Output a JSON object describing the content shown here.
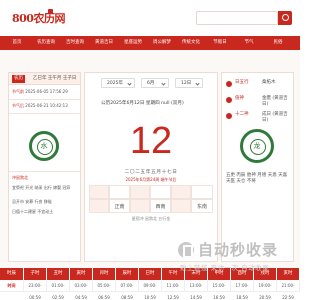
{
  "header": {
    "logo": "800农历网",
    "search_placeholder": ""
  },
  "nav": [
    "首页",
    "农历查询",
    "吉时查询",
    "黄道吉日",
    "星座运势",
    "周公解梦",
    "传统文化",
    "节假日",
    "节气",
    "民俗"
  ],
  "left_card": {
    "tag": "农历",
    "date": "乙巳年 壬午月 壬子日",
    "rows": [
      {
        "label": "节气前",
        "value": "2025-06-05 17:56:29"
      },
      {
        "label": "节气后",
        "value": "2025-06-21 10:42:13"
      }
    ],
    "ring_char": "水",
    "bottom_lines": [
      "冲鼠煞北",
      "宜祭祀 开光 纳采 出行 嫁娶 冠笄",
      "忌开市 安葬 行丧 移徙",
      "日值十二建星 不宜动土"
    ]
  },
  "center": {
    "year_sel": "2025年",
    "month_sel": "6月",
    "day_sel": "12日",
    "date_line": "公历2025年6月12日  星期四  null  (双月)",
    "day_number": "12",
    "lunar": "二〇二五年五月十七日",
    "holiday": "2025年6月第24周 端午节后",
    "grid_row1": [
      "",
      "",
      "",
      "",
      "",
      ""
    ],
    "grid_row2": [
      "",
      "正南",
      "",
      "西南",
      "",
      "东南"
    ],
    "footer": "星宿冲 鼠煞北 五行金"
  },
  "right_card": {
    "rows": [
      {
        "label": "日五行",
        "value": "桑柘木"
      },
      {
        "label": "值神",
        "value": "金匮 (黄道吉日)"
      },
      {
        "label": "十二神",
        "value": "成日 (黄道吉日)"
      }
    ],
    "ring_char": "龙",
    "bottom_text": "五更 丙辰 胎神 月德 天恩 天喜 天医 天仓 不将"
  },
  "table": {
    "headers": [
      "时辰",
      "子时",
      "丑时",
      "寅时",
      "卯时",
      "辰时",
      "巳时",
      "午时",
      "未时",
      "申时",
      "酉时",
      "戌时",
      "亥时"
    ],
    "values": [
      "时间",
      "23:00-00:59",
      "01:00-02:59",
      "03:00-04:59",
      "05:00-06:59",
      "07:00-08:59",
      "09:00-10:59",
      "11:00-12:59",
      "13:00-14:59",
      "15:00-16:59",
      "17:00-18:59",
      "19:00-20:59",
      "21:00-22:59"
    ]
  },
  "watermark": {
    "title": "自动秒收录",
    "subtitle": "致上链接·来访一次·自动收录"
  },
  "colors": {
    "primary": "#c9281e",
    "accent_green": "#2f7a3a",
    "panel_bg": "#fcefe9"
  }
}
